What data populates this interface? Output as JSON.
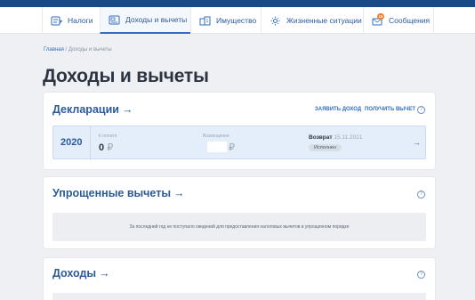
{
  "nav": {
    "items": [
      {
        "label": "Налоги",
        "icon": "tax-icon"
      },
      {
        "label": "Доходы и вычеты",
        "icon": "income-icon",
        "active": true
      },
      {
        "label": "Имущество",
        "icon": "property-icon"
      },
      {
        "label": "Жизненные ситуации",
        "icon": "situations-icon"
      },
      {
        "label": "Сообщения",
        "icon": "messages-icon",
        "badge": "15"
      }
    ]
  },
  "breadcrumb": {
    "home": "Главная",
    "separator": " / ",
    "current": "Доходы и вычеты"
  },
  "page_title": "Доходы и вычеты",
  "declarations": {
    "title": "Декларации",
    "arrow": "→",
    "actions": {
      "declare_income": "ЗАЯВИТЬ ДОХОД",
      "get_deduction": "ПОЛУЧИТЬ ВЫЧЕТ"
    },
    "help": "?",
    "row": {
      "year": "2020",
      "to_pay_label": "К оплате",
      "to_pay_value": "0",
      "currency": "₽",
      "refund_label": "Возмещение",
      "return_label": "Возврат",
      "return_date": "15.11.2021",
      "status": "Исполнен",
      "arrow": "→"
    }
  },
  "simplified": {
    "title": "Упрощенные вычеты",
    "arrow": "→",
    "help": "?",
    "notice": "За последний год не поступало сведений для предоставления налоговых вычетов в упрощенном порядке"
  },
  "income": {
    "title": "Доходы",
    "arrow": "→",
    "help": "?"
  },
  "colors": {
    "accent": "#2f6ec1",
    "brand": "#1a4a86",
    "background": "#eef0f3"
  }
}
